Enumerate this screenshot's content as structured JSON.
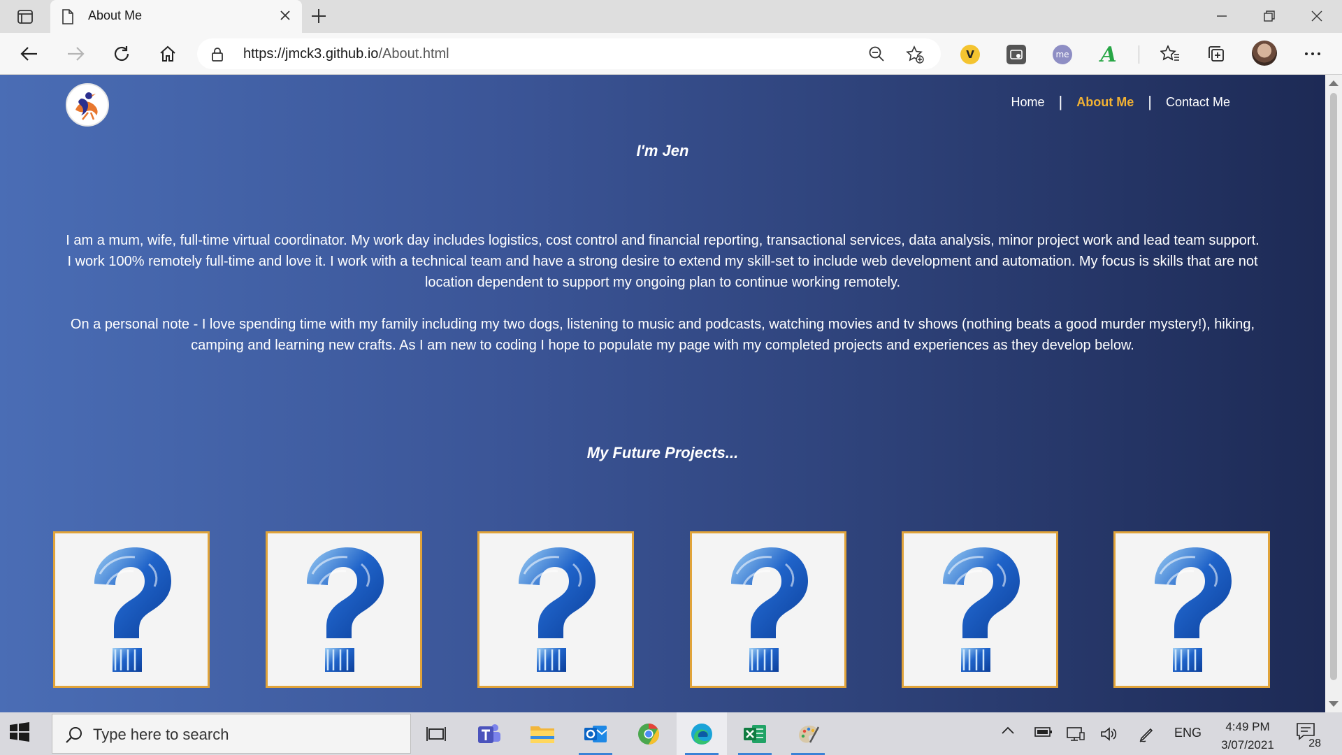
{
  "browser": {
    "tab": {
      "title": "About Me"
    },
    "address": {
      "host": "https://jmck3.github.io",
      "path": "/About.html"
    },
    "toolbar_icons": [
      "back-arrow-icon",
      "forward-arrow-icon",
      "refresh-icon",
      "home-icon",
      "lock-icon",
      "zoom-icon",
      "add-favorite-icon",
      "favorites-icon",
      "collections-icon",
      "more-icon"
    ],
    "extensions": [
      {
        "name": "v-extension",
        "label": "V"
      },
      {
        "name": "screenshot-extension",
        "label": ""
      },
      {
        "name": "me-extension",
        "label": "me"
      },
      {
        "name": "a-extension",
        "label": "A"
      }
    ]
  },
  "site": {
    "nav": {
      "items": [
        {
          "label": "Home",
          "active": false
        },
        {
          "label": "About Me",
          "active": true
        },
        {
          "label": "Contact Me",
          "active": false
        }
      ],
      "separator": "|"
    },
    "title": "I'm Jen",
    "bio_paragraphs": [
      "I am a mum, wife, full-time virtual coordinator. My work day includes logistics, cost control and financial reporting, transactional services, data analysis, minor project work and lead team support. I work 100% remotely full-time and love it. I work with a technical team and have a strong desire to extend my skill-set to include web development and automation. My focus is skills that are not location dependent to support my ongoing plan to continue working remotely.",
      "On a personal note - I love spending time with my family including my two dogs, listening to music and podcasts, watching movies and tv shows (nothing beats a good murder mystery!), hiking, camping and learning new crafts. As I am new to coding I hope to populate my page with my completed projects and experiences as they develop below."
    ],
    "projects_title": "My Future Projects...",
    "project_cards": 6,
    "colors": {
      "accent": "#f2b233",
      "card_border": "#e0a33a",
      "question_blue": "#1f63c9"
    }
  },
  "taskbar": {
    "search_placeholder": "Type here to search",
    "apps": [
      "task-view-icon",
      "teams-icon",
      "file-explorer-icon",
      "outlook-icon",
      "chrome-icon",
      "edge-icon",
      "excel-icon",
      "paint-icon"
    ],
    "language": "ENG",
    "time": "4:49 PM",
    "date": "3/07/2021",
    "notification_count": "28"
  }
}
